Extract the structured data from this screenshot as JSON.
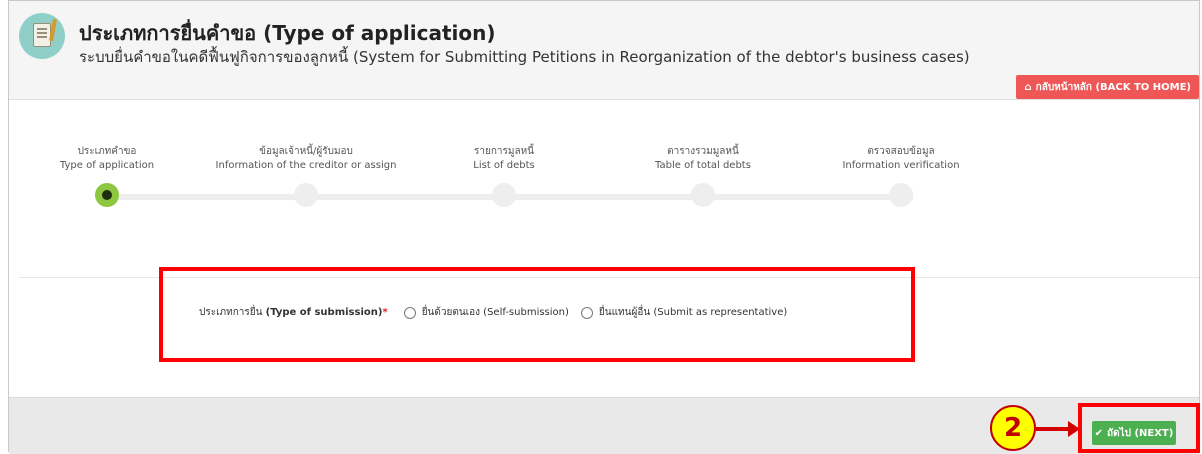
{
  "header": {
    "title": "ประเภทการยื่นคำขอ (Type of application)",
    "subtitle": "ระบบยื่นคำขอในคดีฟื้นฟูกิจการของลูกหนี้ (System for Submitting Petitions in Reorganization of the debtor's business cases)",
    "icon": "document-pen-icon",
    "back_home_label": "กลับหน้าหลัก (BACK TO HOME)"
  },
  "steps": [
    {
      "th": "ประเภทคำขอ",
      "en": "Type of application",
      "active": true
    },
    {
      "th": "ข้อมูลเจ้าหนี้/ผู้รับมอบ",
      "en": "Information of the creditor or assign",
      "active": false
    },
    {
      "th": "รายการมูลหนี้",
      "en": "List of debts",
      "active": false
    },
    {
      "th": "ตารางรวมมูลหนี้",
      "en": "Table of total debts",
      "active": false
    },
    {
      "th": "ตรวจสอบข้อมูล",
      "en": "Information verification",
      "active": false
    }
  ],
  "form": {
    "label_th": "ประเภทการยื่น",
    "label_en": "(Type of submission)",
    "required_mark": "*",
    "options": [
      {
        "label": "ยื่นด้วยตนเอง (Self-submission)",
        "selected": false
      },
      {
        "label": "ยื่นแทนผู้อื่น (Submit as representative)",
        "selected": false
      }
    ]
  },
  "footer": {
    "next_label": "ถัดไป (NEXT)",
    "callout_number": "2"
  },
  "colors": {
    "accent_green": "#8dc63f",
    "next_green": "#4caf50",
    "back_red": "#ef5656",
    "highlight_red": "#ff0000",
    "badge_yellow": "#ffff00"
  }
}
